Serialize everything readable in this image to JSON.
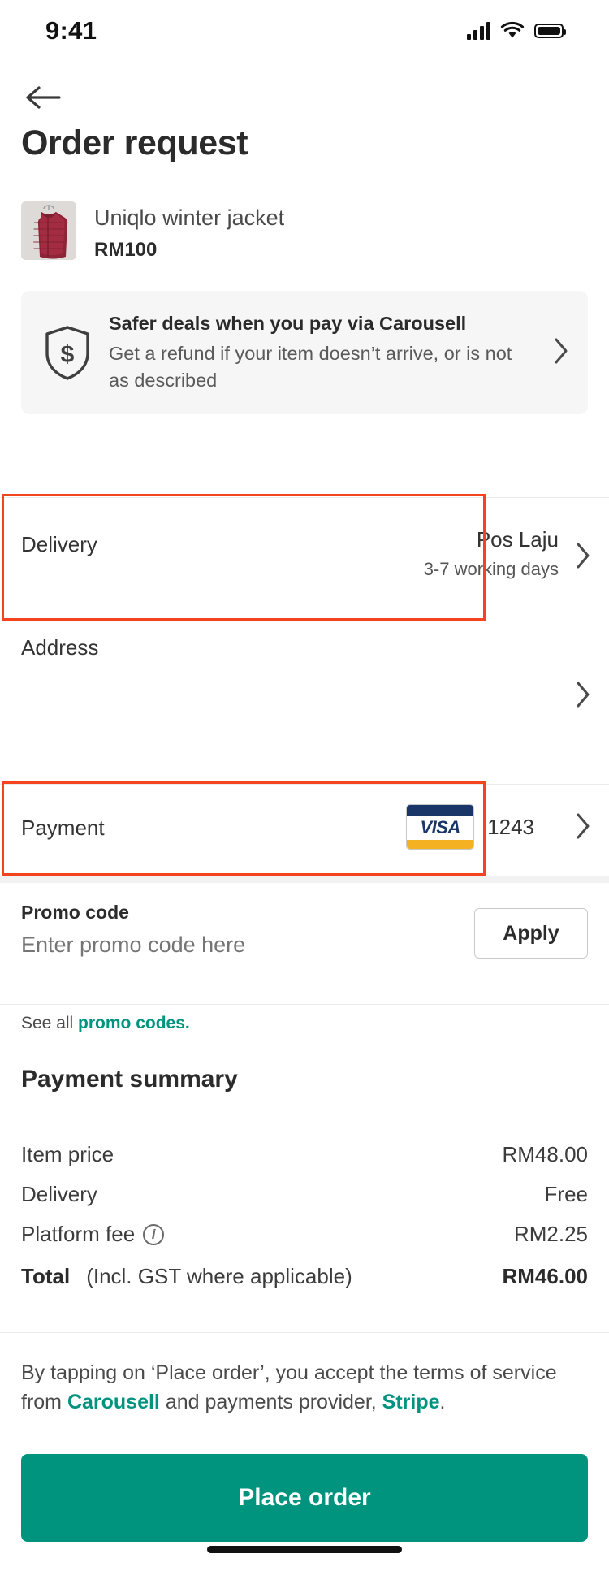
{
  "status_bar": {
    "time": "9:41",
    "signal_icon": "cellular-bars-icon",
    "wifi_icon": "wifi-icon",
    "battery_icon": "battery-icon"
  },
  "header": {
    "back_icon": "back-arrow-icon",
    "title": "Order request"
  },
  "product": {
    "title": "Uniqlo winter jacket",
    "price": "RM100",
    "image_alt": "maroon puffer jacket on hanger"
  },
  "safer_banner": {
    "icon": "shield-dollar-icon",
    "title": "Safer deals when you pay via Carousell",
    "subtitle": "Get a refund if your item doesn’t arrive, or is not as described",
    "chevron": "chevron-right-icon"
  },
  "delivery": {
    "label": "Delivery",
    "value": "Pos Laju",
    "sub": "3-7 working days",
    "chevron": "chevron-right-icon"
  },
  "address": {
    "label": "Address",
    "value": "",
    "chevron": "chevron-right-icon"
  },
  "payment": {
    "label": "Payment",
    "card_brand": "VISA",
    "card_last4": "1243",
    "chevron": "chevron-right-icon"
  },
  "promo": {
    "label": "Promo code",
    "placeholder": "Enter promo code here",
    "value": "",
    "apply_label": "Apply",
    "see_all_prefix": "See all ",
    "see_all_link": "promo codes."
  },
  "summary": {
    "title": "Payment summary",
    "rows": [
      {
        "label": "Item price",
        "value": "RM48.00",
        "info": false
      },
      {
        "label": "Delivery",
        "value": "Free",
        "info": false
      },
      {
        "label": "Platform fee",
        "value": "RM2.25",
        "info": true,
        "info_icon": "info-circle-icon"
      }
    ],
    "total": {
      "label": "Total",
      "note": "(Incl. GST where applicable)",
      "value": "RM46.00"
    }
  },
  "footer": {
    "terms_1": "By tapping on ‘Place order’, you accept the terms of service from ",
    "terms_link_1": "Carousell",
    "terms_2": " and payments provider, ",
    "terms_link_2": "Stripe",
    "terms_3": ".",
    "place_order_label": "Place order"
  },
  "colors": {
    "accent": "#00947e",
    "link": "#00937f",
    "highlight": "#f4441e",
    "visa_navy": "#1a3668",
    "visa_gold": "#f4b223"
  }
}
